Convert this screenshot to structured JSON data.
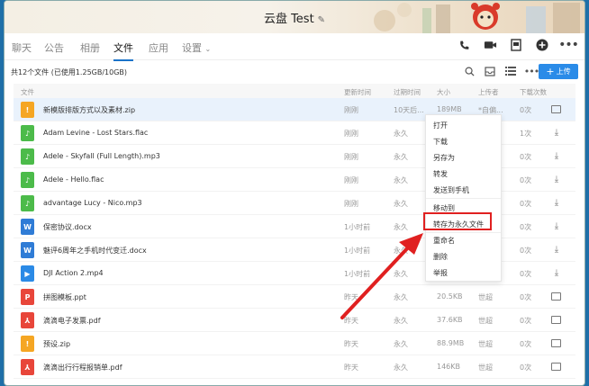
{
  "window": {
    "title": "云盘 Test"
  },
  "tabs": [
    {
      "label": "聊天",
      "active": false
    },
    {
      "label": "公告",
      "active": false
    },
    {
      "label": "相册",
      "active": false
    },
    {
      "label": "文件",
      "active": true
    },
    {
      "label": "应用",
      "active": false
    },
    {
      "label": "设置",
      "active": false
    }
  ],
  "header_icons": [
    "phone-icon",
    "video-icon",
    "doc-icon",
    "add-icon",
    "more-icon"
  ],
  "toolbar": {
    "usage": "共12个文件 (已使用1.25GB/10GB)",
    "upload_label": "上传"
  },
  "columns": {
    "name": "文件",
    "updated": "更新时间",
    "expire": "过期时间",
    "size": "大小",
    "uploader": "上传者",
    "downloads": "下载次数"
  },
  "files": [
    {
      "name": "新模版排版方式以及素材.zip",
      "type": "zip",
      "updated": "刚刚",
      "expire": "10天后...",
      "size": "189MB",
      "uploader": "*自偏...",
      "downloads": "0次",
      "action": "folder",
      "color": "#f5a623",
      "glyph": "!"
    },
    {
      "name": "Adam Levine - Lost Stars.flac",
      "type": "audio",
      "updated": "刚刚",
      "expire": "永久",
      "size": "",
      "uploader": "",
      "downloads": "1次",
      "action": "download",
      "color": "#4cbb4a",
      "glyph": "♪"
    },
    {
      "name": "Adele - Skyfall (Full Length).mp3",
      "type": "audio",
      "updated": "刚刚",
      "expire": "永久",
      "size": "",
      "uploader": "",
      "downloads": "0次",
      "action": "download",
      "color": "#4cbb4a",
      "glyph": "♪"
    },
    {
      "name": "Adele - Hello.flac",
      "type": "audio",
      "updated": "刚刚",
      "expire": "永久",
      "size": "",
      "uploader": "",
      "downloads": "0次",
      "action": "download",
      "color": "#4cbb4a",
      "glyph": "♪"
    },
    {
      "name": "advantage Lucy - Nico.mp3",
      "type": "audio",
      "updated": "刚刚",
      "expire": "永久",
      "size": "",
      "uploader": "",
      "downloads": "0次",
      "action": "download",
      "color": "#4cbb4a",
      "glyph": "♪"
    },
    {
      "name": "保密协议.docx",
      "type": "word",
      "updated": "1小时前",
      "expire": "永久",
      "size": "",
      "uploader": "",
      "downloads": "0次",
      "action": "download",
      "color": "#2f7cd6",
      "glyph": "W"
    },
    {
      "name": "魅评6周年之手机时代变迁.docx",
      "type": "word",
      "updated": "1小时前",
      "expire": "永久",
      "size": "",
      "uploader": "",
      "downloads": "0次",
      "action": "download",
      "color": "#2f7cd6",
      "glyph": "W"
    },
    {
      "name": "DJI Action 2.mp4",
      "type": "video",
      "updated": "1小时前",
      "expire": "永久",
      "size": "",
      "uploader": "",
      "downloads": "0次",
      "action": "download",
      "color": "#2b8ae6",
      "glyph": "▶"
    },
    {
      "name": "拼图模板.ppt",
      "type": "ppt",
      "updated": "昨天",
      "expire": "永久",
      "size": "20.5KB",
      "uploader": "世超",
      "downloads": "0次",
      "action": "folder",
      "color": "#e8463a",
      "glyph": "P"
    },
    {
      "name": "滴滴电子发票.pdf",
      "type": "pdf",
      "updated": "昨天",
      "expire": "永久",
      "size": "37.6KB",
      "uploader": "世超",
      "downloads": "0次",
      "action": "folder",
      "color": "#e8463a",
      "glyph": "⅄"
    },
    {
      "name": "预设.zip",
      "type": "zip",
      "updated": "昨天",
      "expire": "永久",
      "size": "88.9MB",
      "uploader": "世超",
      "downloads": "0次",
      "action": "folder",
      "color": "#f5a623",
      "glyph": "!"
    },
    {
      "name": "滴滴出行行程报销单.pdf",
      "type": "pdf",
      "updated": "昨天",
      "expire": "永久",
      "size": "146KB",
      "uploader": "世超",
      "downloads": "0次",
      "action": "folder",
      "color": "#e8463a",
      "glyph": "⅄"
    }
  ],
  "context_menu": [
    {
      "label": "打开"
    },
    {
      "label": "下载"
    },
    {
      "label": "另存为"
    },
    {
      "label": "转发"
    },
    {
      "label": "发送到手机"
    },
    {
      "label": "移动到"
    },
    {
      "label": "转存为永久文件",
      "highlighted": true
    },
    {
      "label": "重命名"
    },
    {
      "label": "删除"
    },
    {
      "label": "举报"
    }
  ],
  "colors": {
    "accent": "#2a8be8",
    "highlight_box": "#e02020",
    "arrow": "#e02020"
  }
}
